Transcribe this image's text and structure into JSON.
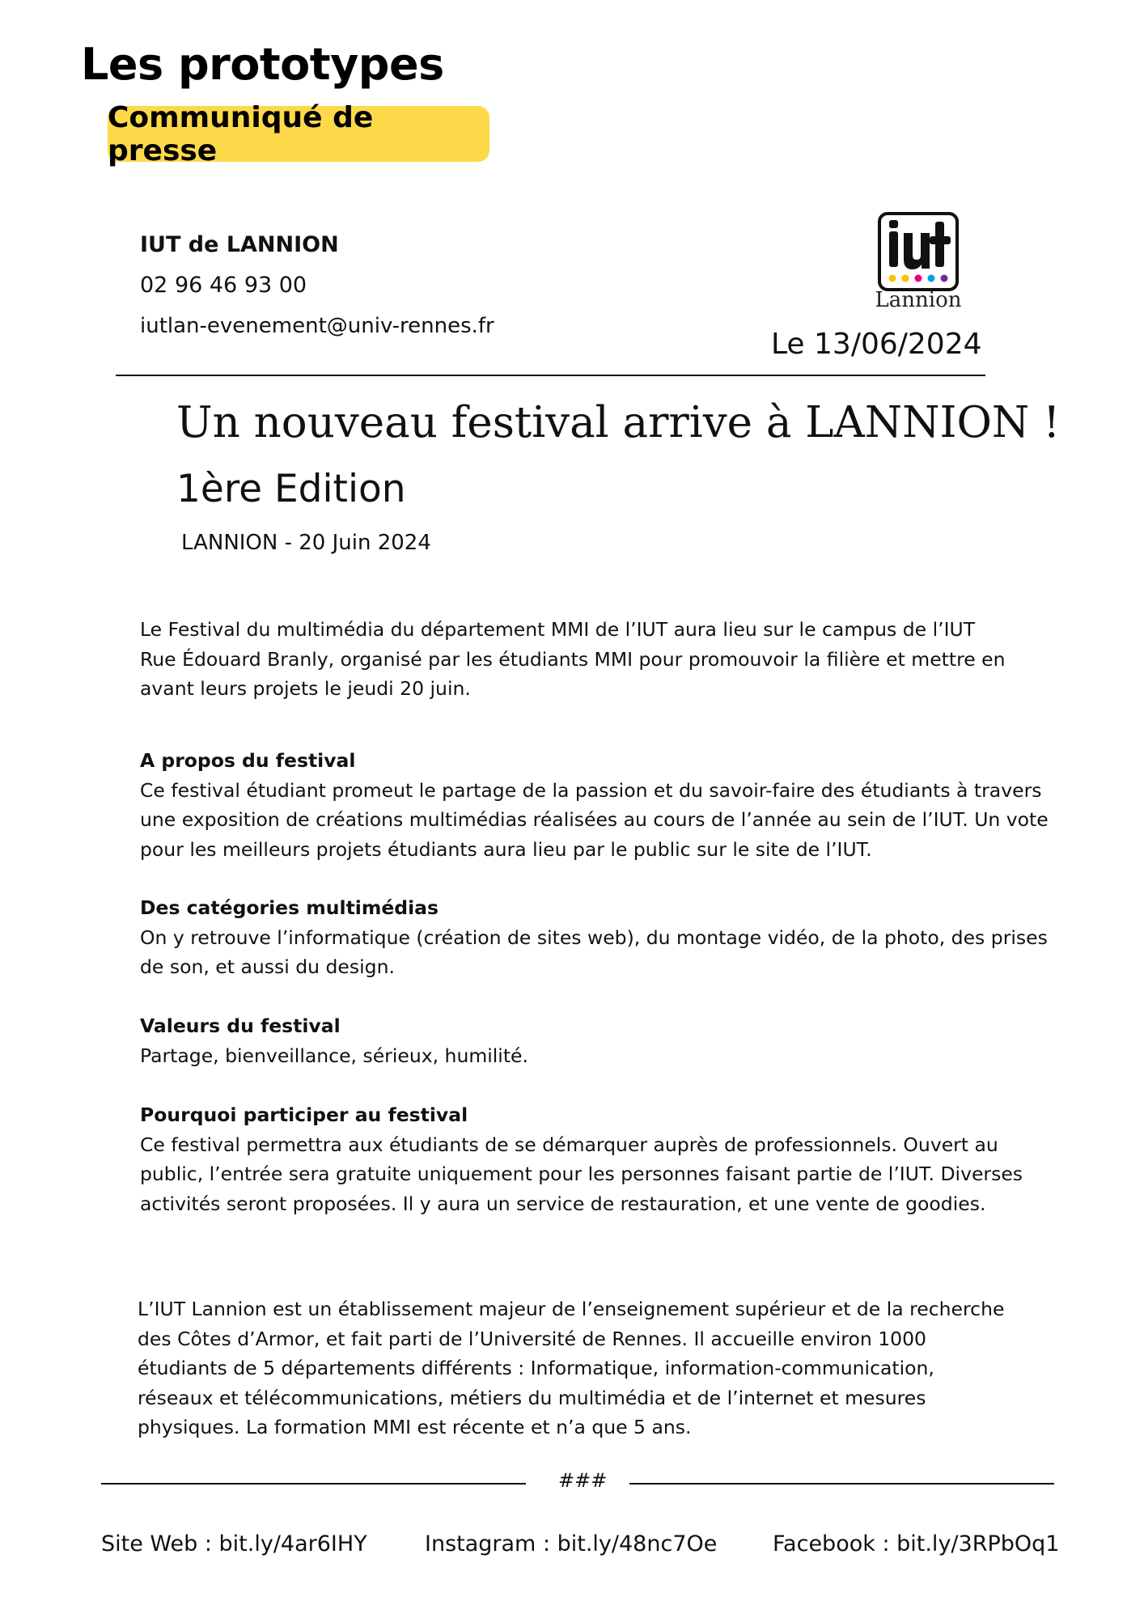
{
  "header": {
    "title": "Les prototypes",
    "badge": "Communiqué de presse"
  },
  "contact": {
    "name": "IUT de LANNION",
    "phone": "02 96 46 93 00",
    "email": "iutlan-evenement@univ-rennes.fr"
  },
  "logo": {
    "name": "Lannion",
    "dot_colors": [
      "#f5c400",
      "#f5c400",
      "#e6007e",
      "#00a0e3",
      "#6f2c91"
    ]
  },
  "date": "Le 13/06/2024",
  "headline": "Un nouveau festival arrive à LANNION !",
  "edition": "1ère Edition",
  "dateline": "LANNION - 20 Juin 2024",
  "intro": [
    "Le Festival du multimédia du département MMI de l’IUT aura lieu sur le campus de l’IUT",
    "Rue Édouard Branly, organisé par les étudiants MMI pour promouvoir la filière et mettre en",
    "avant leurs projets le jeudi 20 juin."
  ],
  "sections": [
    {
      "heading": "A propos du festival",
      "lines": [
        "Ce festival étudiant promeut le partage de la passion et du savoir-faire des étudiants à travers",
        "une exposition de créations multimédias réalisées au cours de l’année au sein de l’IUT. Un vote",
        "pour les meilleurs projets étudiants aura lieu par le public sur le site de l’IUT."
      ]
    },
    {
      "heading": "Des catégories multimédias",
      "lines": [
        "On y retrouve l’informatique (création de sites web), du montage vidéo, de la photo, des prises",
        "de son, et aussi du design."
      ]
    },
    {
      "heading": "Valeurs du festival",
      "lines": [
        "Partage, bienveillance, sérieux, humilité."
      ]
    },
    {
      "heading": "Pourquoi participer au festival",
      "lines": [
        "Ce festival permettra aux étudiants de se démarquer auprès de professionnels. Ouvert au",
        "public, l’entrée sera gratuite uniquement pour les personnes faisant partie de l’IUT. Diverses",
        "activités seront proposées. Il y aura un service de restauration, et une vente de goodies."
      ]
    }
  ],
  "about": [
    "L’IUT Lannion est un établissement majeur de l’enseignement supérieur et de la recherche",
    "des Côtes d’Armor, et fait parti de l’Université de Rennes. Il accueille environ 1000",
    "étudiants de 5 départements différents : Informatique, information-communication,",
    "réseaux et télécommunications, métiers du multimédia et de l’internet et mesures",
    "physiques. La formation MMI est récente et n’a que 5 ans."
  ],
  "footer": {
    "separator": "###",
    "website": "Site Web : bit.ly/4ar6IHY",
    "instagram": "Instagram : bit.ly/48nc7Oe",
    "facebook": "Facebook : bit.ly/3RPbOq1"
  }
}
